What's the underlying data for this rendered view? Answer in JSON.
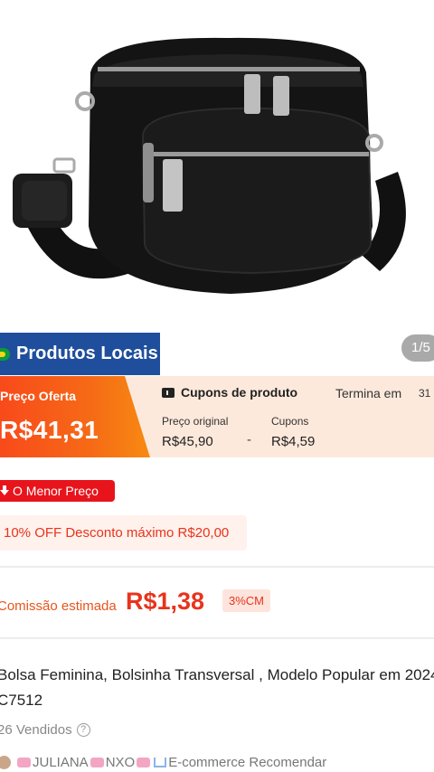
{
  "image": {
    "counter": "1/5"
  },
  "badge": {
    "label": "Produtos Locais"
  },
  "price": {
    "offer_label": "Preço Oferta",
    "offer_value": "R$41,31",
    "coupon_title": "Cupons de produto",
    "ends_label": "Termina em",
    "ends_time": "31",
    "original_label": "Preço original",
    "original_value": "R$45,90",
    "coupon_label": "Cupons",
    "coupon_value": "R$4,59",
    "separator": "-"
  },
  "tags": {
    "lowest_price": "O Menor Preço",
    "discount": "10% OFF Desconto máximo R$20,00"
  },
  "commission": {
    "label": "Comissão estimada",
    "value": "R$1,38",
    "rate": "3%CM"
  },
  "product": {
    "title": "Bolsa Feminina, Bolsinha Transversal , Modelo Popular em 2024 C7512",
    "sold": "26 Vendidos",
    "help": "?"
  },
  "store": {
    "name_a": "JULIANA",
    "name_b": "NXO",
    "tagline": "E-commerce Recomendar"
  },
  "colors": {
    "offer_orange": "#f84a1b",
    "badge_blue": "#1f4e9c",
    "lowest_red": "#e8141c",
    "banner_peach": "#fde9dc"
  }
}
